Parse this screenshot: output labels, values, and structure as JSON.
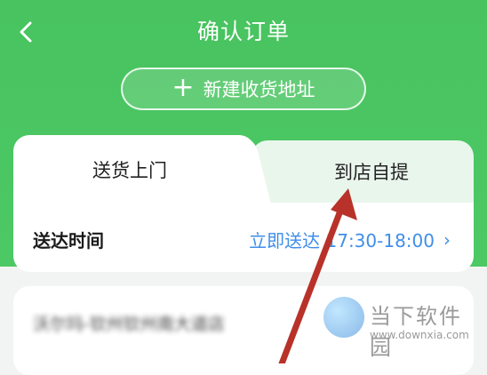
{
  "header": {
    "title": "确认订单",
    "back_icon": "chevron-left-icon"
  },
  "new_address_button": {
    "icon": "plus-icon",
    "label": "新建收货地址"
  },
  "tabs": [
    {
      "label": "送货上门",
      "active": true
    },
    {
      "label": "到店自提",
      "active": false
    }
  ],
  "delivery": {
    "label": "送达时间",
    "value": "立即送达 17:30-18:00",
    "chevron": "›"
  },
  "address_card": {
    "text": "沃尔玛-钦州钦州南大道店"
  },
  "watermark": {
    "text": "当下软件园",
    "url": "www.downxia.com"
  },
  "colors": {
    "header_green": "#4bc562",
    "link_blue": "#3f8ee8",
    "arrow_red": "#b8322a"
  }
}
